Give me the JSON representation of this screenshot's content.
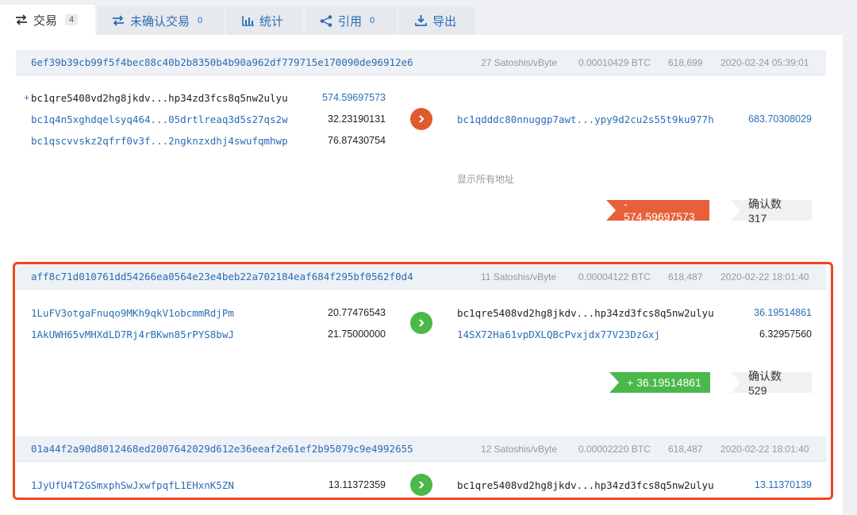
{
  "tabs": [
    {
      "label": "交易",
      "badge": "4",
      "icon": "swap-icon"
    },
    {
      "label": "未确认交易",
      "badge": "0",
      "icon": "swap-icon"
    },
    {
      "label": "统计",
      "badge": "",
      "icon": "bar-chart-icon"
    },
    {
      "label": "引用",
      "badge": "0",
      "icon": "share-icon"
    },
    {
      "label": "导出",
      "badge": "",
      "icon": "download-icon"
    }
  ],
  "colors": {
    "accent": "#2a6db5",
    "sent": "#e8603a",
    "received": "#4bb84a",
    "highlight": "#f0451d"
  },
  "transactions": [
    {
      "hash": "6ef39b39cb99f5f4bec88c40b2b8350b4b90a962df779715e170090de96912e6",
      "fee_rate": "27 Satoshis/vByte",
      "fee": "0.00010429 BTC",
      "block": "618,699",
      "time": "2020-02-24 05:39:01",
      "inputs": [
        {
          "prefix": "+",
          "address": "bc1qre5408vd2hg8jkdv...hp34zd3fcs8q5nw2ulyu",
          "amount": "574.59697573",
          "linked": false
        },
        {
          "prefix": "",
          "address": "bc1q4n5xghdqelsyq464...05drtlreaq3d5s27qs2w",
          "amount": "32.23190131",
          "linked": true
        },
        {
          "prefix": "",
          "address": "bc1qscvvskz2qfrf0v3f...2ngknzxdhj4swufqmhwp",
          "amount": "76.87430754",
          "linked": true
        }
      ],
      "outputs": [
        {
          "address": "bc1qdddc80nnuggp7awt...ypy9d2cu2s55t9ku977h",
          "amount": "683.70308029",
          "linked": true
        }
      ],
      "show_all": "显示所有地址",
      "result": "- 574.59697573",
      "confirmations": "确认数 317"
    },
    {
      "hash": "aff8c71d010761dd54266ea0564e23e4beb22a702184eaf684f295bf0562f0d4",
      "fee_rate": "11 Satoshis/vByte",
      "fee": "0.00004122 BTC",
      "block": "618,487",
      "time": "2020-02-22 18:01:40",
      "inputs": [
        {
          "address": "1LuFV3otgaFnuqo9MKh9qkV1obcmmRdjPm",
          "amount": "20.77476543",
          "linked": true
        },
        {
          "address": "1AkUWH65vMHXdLD7Rj4rBKwn85rPYS8bwJ",
          "amount": "21.75000000",
          "linked": true
        }
      ],
      "outputs": [
        {
          "address": "bc1qre5408vd2hg8jkdv...hp34zd3fcs8q5nw2ulyu",
          "amount": "36.19514861",
          "linked": false
        },
        {
          "address": "14SX72Ha61vpDXLQBcPvxjdx77V23DzGxj",
          "amount": "6.32957560",
          "linked": true
        }
      ],
      "result": "+ 36.19514861",
      "confirmations": "确认数 529"
    },
    {
      "hash": "01a44f2a90d8012468ed2007642029d612e36eeaf2e61ef2b95079c9e4992655",
      "fee_rate": "12 Satoshis/vByte",
      "fee": "0.00002220 BTC",
      "block": "618,487",
      "time": "2020-02-22 18:01:40",
      "inputs": [
        {
          "address": "1JyUfU4T2GSmxphSwJxwfpqfL1EHxnK5ZN",
          "amount": "13.11372359",
          "linked": true
        }
      ],
      "outputs": [
        {
          "address": "bc1qre5408vd2hg8jkdv...hp34zd3fcs8q5nw2ulyu",
          "amount": "13.11370139",
          "linked": false
        }
      ]
    }
  ]
}
